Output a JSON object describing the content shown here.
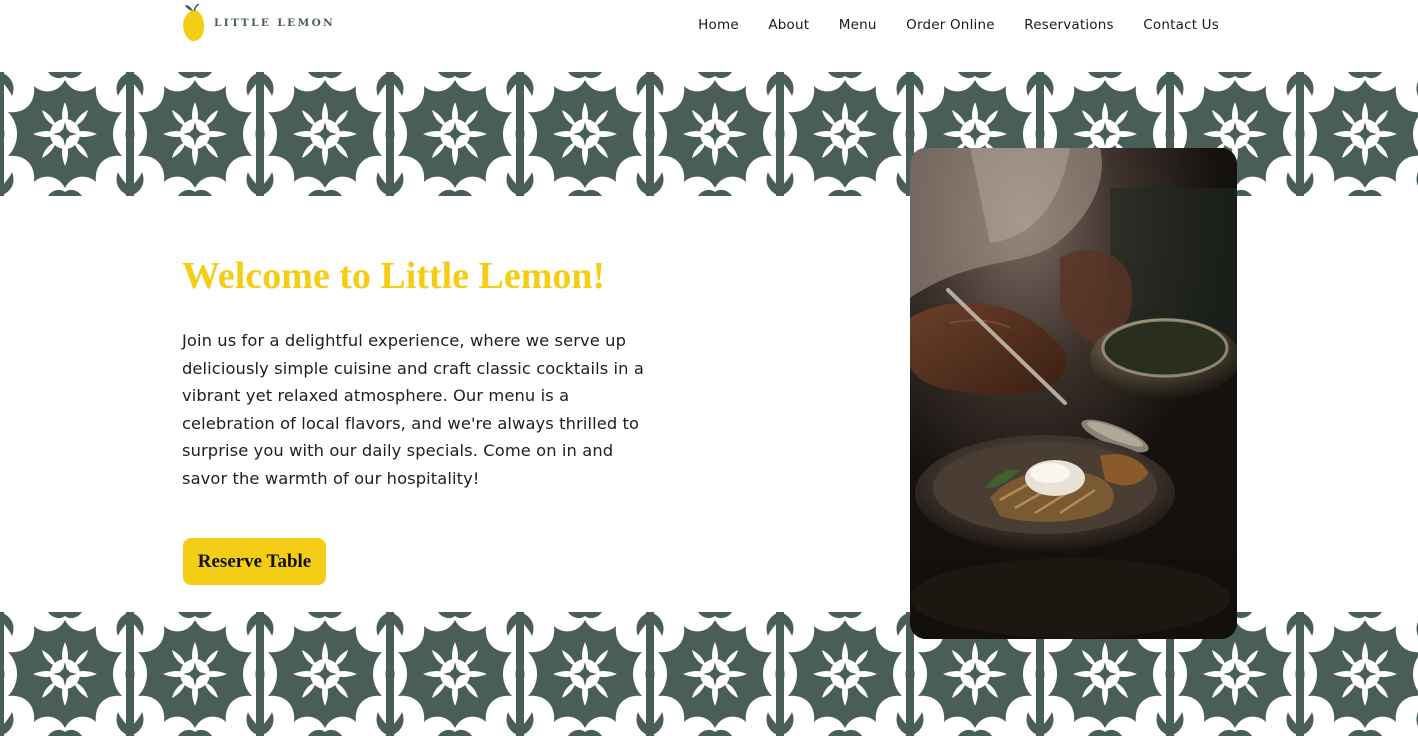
{
  "brand": {
    "name": "LITTLE LEMON",
    "logo_icon": "lemon-icon",
    "accent_yellow": "#F4CE14",
    "primary_green": "#495E57"
  },
  "nav": {
    "items": [
      {
        "label": "Home"
      },
      {
        "label": "About"
      },
      {
        "label": "Menu"
      },
      {
        "label": "Order Online"
      },
      {
        "label": "Reservations"
      },
      {
        "label": "Contact Us"
      }
    ]
  },
  "hero": {
    "title": "Welcome to Little Lemon!",
    "description": "Join us for a delightful experience, where we serve up deliciously simple cuisine and craft classic cocktails in a vibrant yet relaxed atmosphere. Our menu is a celebration of local flavors, and we're always thrilled to surprise you with our daily specials. Come on in and savor the warmth of our hospitality!",
    "cta_label": "Reserve Table"
  }
}
